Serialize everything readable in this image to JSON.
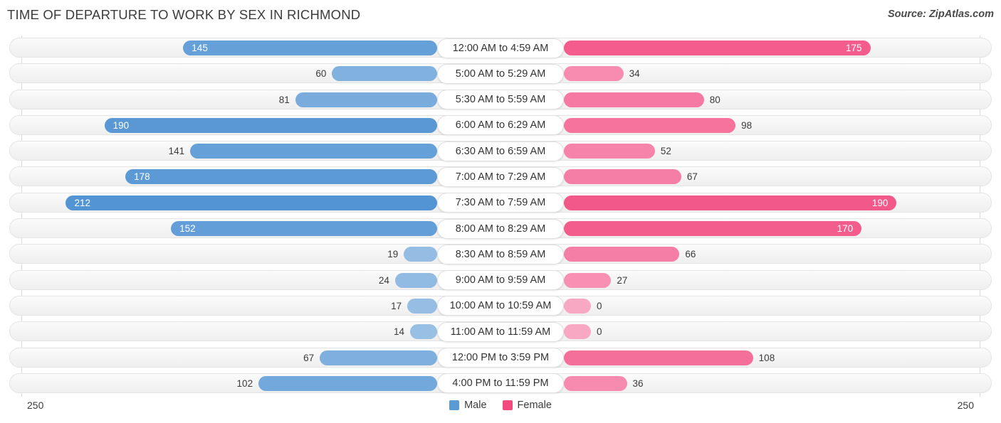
{
  "header": {
    "title": "TIME OF DEPARTURE TO WORK BY SEX IN RICHMOND",
    "source": "Source: ZipAtlas.com"
  },
  "axis": {
    "left_end": "250",
    "right_end": "250",
    "max": 250
  },
  "legend": {
    "items": [
      {
        "label": "Male",
        "color": "#5b9bd5"
      },
      {
        "label": "Female",
        "color": "#f2497f"
      }
    ]
  },
  "colors": {
    "male_min": "#a8c9e8",
    "male_max": "#4a8fd2",
    "female_min": "#f9a8c4",
    "female_max": "#f1497f",
    "track": "#f4f4f4",
    "gridline": "#d9d9d9"
  },
  "chart_data": {
    "type": "bar",
    "orientation": "horizontal-diverging",
    "title": "TIME OF DEPARTURE TO WORK BY SEX IN RICHMOND",
    "xlabel": "",
    "ylabel": "",
    "xlim": [
      250,
      250
    ],
    "grid": true,
    "legend_position": "bottom-center",
    "categories": [
      "12:00 AM to 4:59 AM",
      "5:00 AM to 5:29 AM",
      "5:30 AM to 5:59 AM",
      "6:00 AM to 6:29 AM",
      "6:30 AM to 6:59 AM",
      "7:00 AM to 7:29 AM",
      "7:30 AM to 7:59 AM",
      "8:00 AM to 8:29 AM",
      "8:30 AM to 8:59 AM",
      "9:00 AM to 9:59 AM",
      "10:00 AM to 10:59 AM",
      "11:00 AM to 11:59 AM",
      "12:00 PM to 3:59 PM",
      "4:00 PM to 11:59 PM"
    ],
    "series": [
      {
        "name": "Male",
        "side": "left",
        "values": [
          145,
          60,
          81,
          190,
          141,
          178,
          212,
          152,
          19,
          24,
          17,
          14,
          67,
          102
        ],
        "labels": [
          "145",
          "60",
          "81",
          "190",
          "141",
          "178",
          "212",
          "152",
          "19",
          "24",
          "17",
          "14",
          "67",
          "102"
        ]
      },
      {
        "name": "Female",
        "side": "right",
        "values": [
          175,
          34,
          80,
          98,
          52,
          67,
          190,
          170,
          66,
          27,
          0,
          0,
          108,
          36
        ],
        "labels": [
          "175",
          "34",
          "80",
          "98",
          "52",
          "67",
          "190",
          "170",
          "66",
          "27",
          "0",
          "0",
          "108",
          "36"
        ]
      }
    ]
  }
}
